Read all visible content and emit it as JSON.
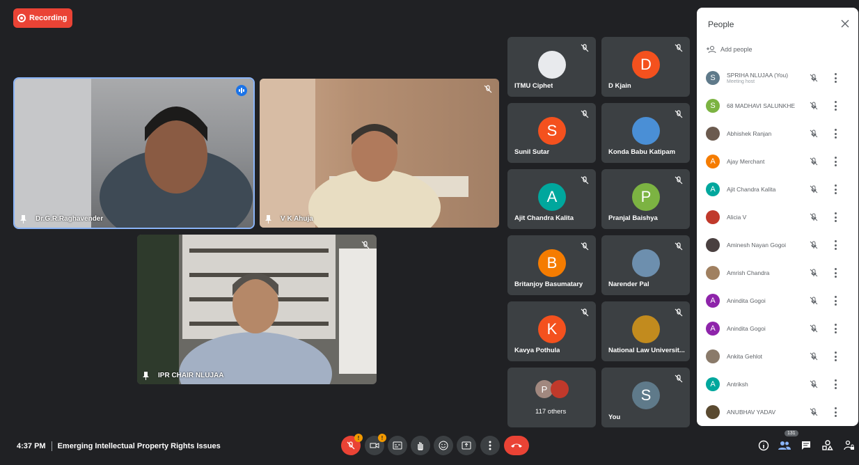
{
  "recording": {
    "label": "Recording"
  },
  "main_tiles": [
    {
      "name": "Dr.G.R.Raghavender",
      "bg": "#8a8c8e"
    },
    {
      "name": "V K Ahuja",
      "bg": "#b89a80"
    },
    {
      "name": "IPR CHAIR NLUJAA",
      "bg": "#6f6e6a"
    }
  ],
  "grid": [
    {
      "name": "ITMU Ciphet",
      "initial": "",
      "color": "#e8eaed",
      "icon": "logo-icon"
    },
    {
      "name": "D Kjain",
      "initial": "D",
      "color": "#f4511e"
    },
    {
      "name": "Sunil Sutar",
      "initial": "S",
      "color": "#f4511e"
    },
    {
      "name": "Konda Babu Katipam",
      "initial": "",
      "color": "#4a8fd6",
      "icon": "flag-avatar-icon"
    },
    {
      "name": "Ajit Chandra Kalita",
      "initial": "A",
      "color": "#00a79d"
    },
    {
      "name": "Pranjal Baishya",
      "initial": "P",
      "color": "#7cb342"
    },
    {
      "name": "Britanjoy Basumatary",
      "initial": "B",
      "color": "#f57c00"
    },
    {
      "name": "Narender Pal",
      "initial": "",
      "color": "#6d8fae",
      "icon": "photo-avatar-icon"
    },
    {
      "name": "Kavya Pothula",
      "initial": "K",
      "color": "#f4511e"
    },
    {
      "name": "National Law Universit...",
      "initial": "",
      "color": "#c28b1e",
      "icon": "emblem-icon"
    },
    {
      "name": "117 others",
      "initial": "P",
      "color": "#a1887f"
    },
    {
      "name": "You",
      "initial": "S",
      "color": "#5f7a8a"
    }
  ],
  "people": {
    "title": "People",
    "add_label": "Add people",
    "list": [
      {
        "name": "SPRIHA NLUJAA (You)",
        "sub": "Meeting host",
        "initial": "S",
        "color": "#5f7a8a"
      },
      {
        "name": "68 MADHAVI SALUNKHE",
        "sub": "",
        "initial": "S",
        "color": "#7cb342"
      },
      {
        "name": "Abhishek Ranjan",
        "sub": "",
        "initial": "",
        "color": "#6b5a4e"
      },
      {
        "name": "Ajay Merchant",
        "sub": "",
        "initial": "A",
        "color": "#f57c00"
      },
      {
        "name": "Ajit Chandra Kalita",
        "sub": "",
        "initial": "A",
        "color": "#00a79d"
      },
      {
        "name": "Alicia V",
        "sub": "",
        "initial": "",
        "color": "#c0392b"
      },
      {
        "name": "Aminesh Nayan Gogoi",
        "sub": "",
        "initial": "",
        "color": "#4a4040"
      },
      {
        "name": "Amrish Chandra",
        "sub": "",
        "initial": "",
        "color": "#a08060"
      },
      {
        "name": "Anindita Gogoi",
        "sub": "",
        "initial": "A",
        "color": "#8e24aa"
      },
      {
        "name": "Anindita Gogoi",
        "sub": "",
        "initial": "A",
        "color": "#8e24aa"
      },
      {
        "name": "Ankita Gehlot",
        "sub": "",
        "initial": "",
        "color": "#8a7a6a"
      },
      {
        "name": "Antriksh",
        "sub": "",
        "initial": "A",
        "color": "#00a79d"
      },
      {
        "name": "ANUBHAV YADAV",
        "sub": "",
        "initial": "",
        "color": "#5a4a30"
      }
    ]
  },
  "footer": {
    "time": "4:37 PM",
    "meeting_title": "Emerging Intellectual Property Rights Issues",
    "participant_count": "131",
    "mic_badge": "!",
    "cam_badge": "!"
  }
}
